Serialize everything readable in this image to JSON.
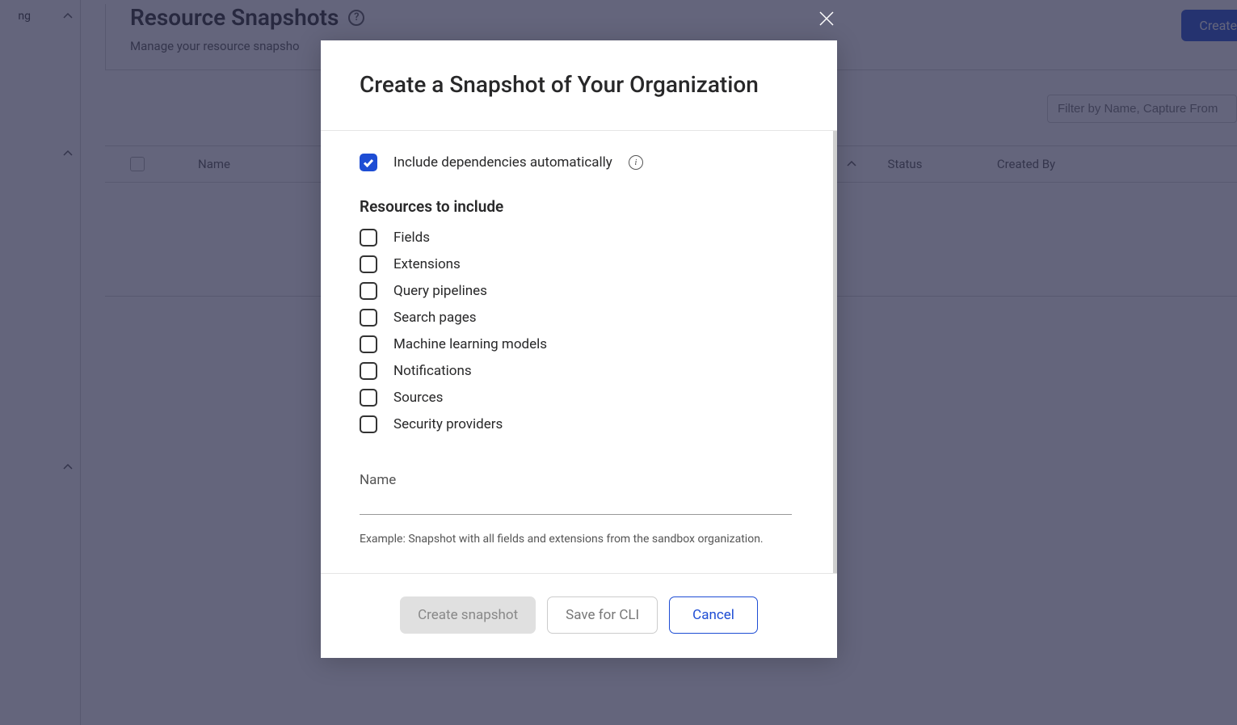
{
  "background": {
    "sidebar_item": "ng",
    "page_title": "Resource Snapshots",
    "page_subtitle": "Manage your resource snapsho",
    "create_button": "Create",
    "filter_placeholder": "Filter by Name, Capture From",
    "columns": {
      "name": "Name",
      "status": "Status",
      "created_by": "Created By"
    }
  },
  "modal": {
    "title": "Create a Snapshot of Your Organization",
    "include_dependencies": "Include dependencies automatically",
    "resources_heading": "Resources to include",
    "resources": [
      "Fields",
      "Extensions",
      "Query pipelines",
      "Search pages",
      "Machine learning models",
      "Notifications",
      "Sources",
      "Security providers"
    ],
    "name_label": "Name",
    "name_example": "Example: Snapshot with all fields and extensions from the sandbox organization.",
    "buttons": {
      "create": "Create snapshot",
      "save_cli": "Save for CLI",
      "cancel": "Cancel"
    }
  }
}
